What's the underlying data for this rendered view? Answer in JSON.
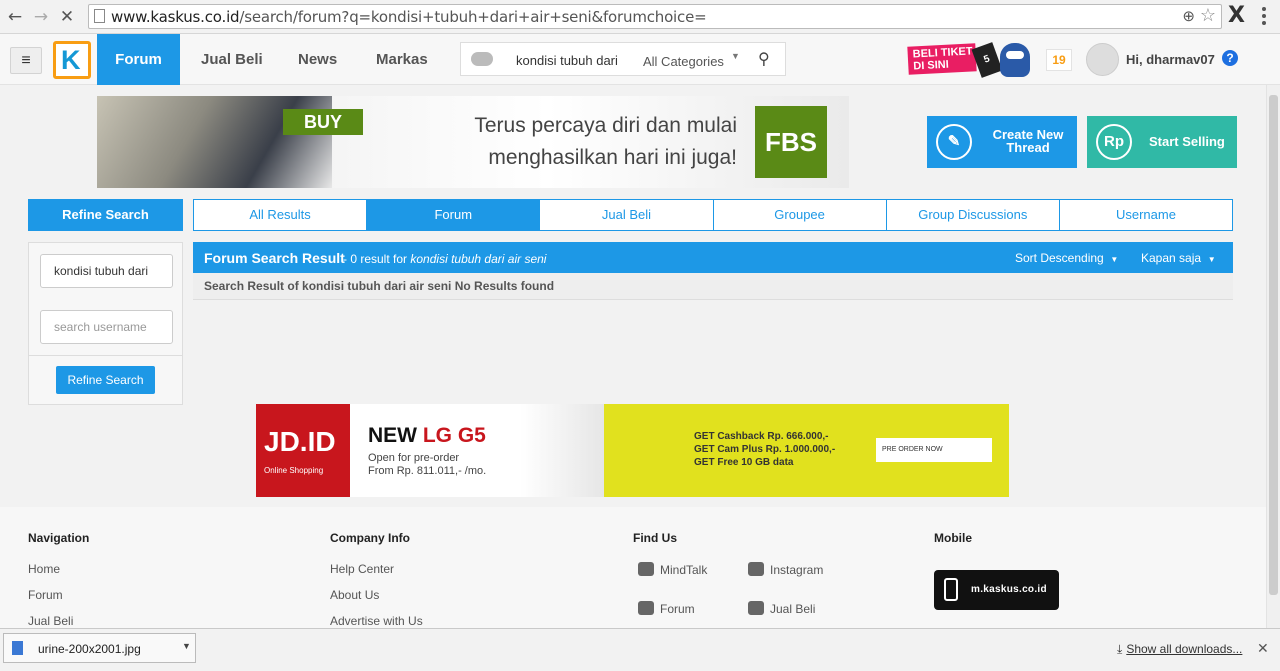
{
  "browser": {
    "url_host": "www.kaskus.co.id",
    "url_path": "/search/forum?q=kondisi+tubuh+dari+air+seni&forumchoice=",
    "ext_label": "X"
  },
  "header": {
    "logo_letter": "K",
    "nav": [
      "Forum",
      "Jual Beli",
      "News",
      "Markas"
    ],
    "search_value": "kondisi tubuh dari",
    "category": "All Categories",
    "promo_line1": "BELI TIKET",
    "promo_line2": "DI SINI",
    "promo_badge": "5",
    "notif_count": "19",
    "greeting": "Hi, dharmav07",
    "help": "?"
  },
  "ad_fbs": {
    "buy": "BUY",
    "tagline": "Terus percaya diri dan mulai menghasilkan hari ini juga!",
    "brand": "FBS"
  },
  "actions": {
    "create_thread": "Create New Thread",
    "start_selling": "Start Selling",
    "rp": "Rp"
  },
  "refine": {
    "header": "Refine Search",
    "query_value": "kondisi tubuh dari",
    "username_placeholder": "search username",
    "button": "Refine Search"
  },
  "tabs": [
    {
      "label": "All Results",
      "active": false
    },
    {
      "label": "Forum",
      "active": true
    },
    {
      "label": "Jual Beli",
      "active": false
    },
    {
      "label": "Groupee",
      "active": false
    },
    {
      "label": "Group Discussions",
      "active": false
    },
    {
      "label": "Username",
      "active": false
    }
  ],
  "results": {
    "title": "Forum Search Result",
    "count_text": "- 0 result for",
    "query_italic": "kondisi tubuh dari air seni",
    "sort": "Sort Descending",
    "time": "Kapan saja",
    "no_results": "Search Result of kondisi tubuh dari air seni No Results found"
  },
  "ad_jd": {
    "logo": "JD.ID",
    "logo_sub": "Online Shopping",
    "headline_a": "NEW ",
    "headline_b": "LG G5",
    "line1": "Open for pre-order",
    "line2": "From Rp. 811.011,- /mo.",
    "offer1": "GET Cashback Rp. 666.000,-",
    "offer2": "GET Cam Plus Rp. 1.000.000,-",
    "offer3": "GET Free 10 GB data",
    "order": "PRE ORDER NOW"
  },
  "footer": {
    "navigation": {
      "title": "Navigation",
      "links": [
        "Home",
        "Forum",
        "Jual Beli"
      ]
    },
    "company": {
      "title": "Company Info",
      "links": [
        "Help Center",
        "About Us",
        "Advertise with Us"
      ]
    },
    "findus": {
      "title": "Find Us",
      "mindtalk": "MindTalk",
      "instagram": "Instagram",
      "forum": "Forum",
      "jualbeli": "Jual Beli"
    },
    "mobile": {
      "title": "Mobile",
      "badge": "m.kaskus.co.id"
    }
  },
  "downloads": {
    "file": "urine-200x2001.jpg",
    "show_all": "Show all downloads..."
  }
}
